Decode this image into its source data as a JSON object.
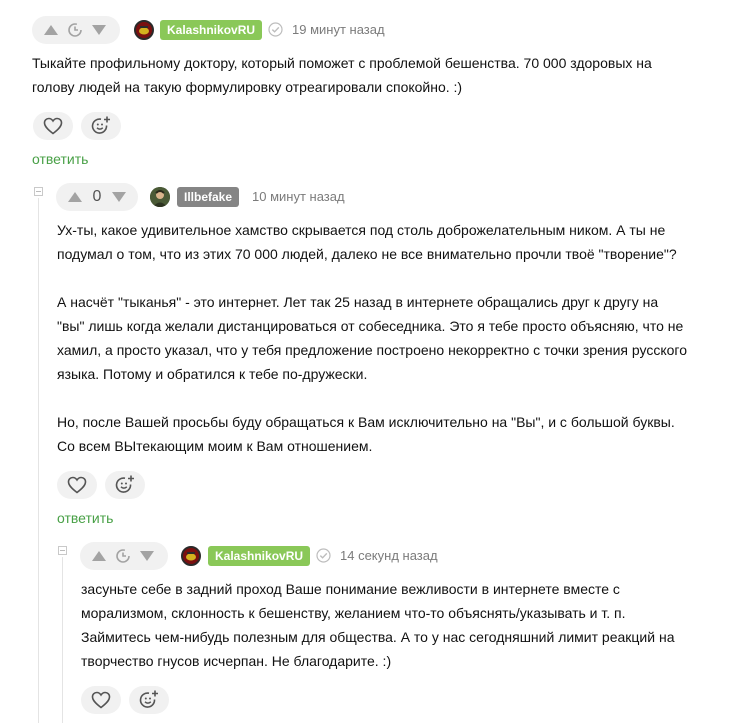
{
  "colors": {
    "accent_green": "#48a046",
    "badge_green": "#8ac858",
    "badge_gray": "#858585",
    "muted_text": "#7b7b7b",
    "pill_bg": "#f1f1f1"
  },
  "icons": {
    "upvote": "triangle-up-icon",
    "downvote": "triangle-down-icon",
    "pending_rating": "rating-timer-icon",
    "verified": "verified-check-icon",
    "like": "heart-icon",
    "react": "smiley-plus-icon"
  },
  "comments": [
    {
      "rating": "",
      "author": "KalashnikovRU",
      "time": "19 минут назад",
      "paragraphs": [
        "Тыкайте профильному доктору, который поможет с проблемой бешенства. 70 000 здоровых на голову людей на такую формулировку отреагировали спокойно. :)"
      ],
      "reply_label": "ответить"
    },
    {
      "rating": "0",
      "author": "Illbefake",
      "time": "10 минут назад",
      "paragraphs": [
        "Ух-ты, какое удивительное хамство скрывается под столь доброжелательным ником. А ты не подумал о том, что из этих 70 000 людей, далеко не все внимательно прочли твоё \"творение\"?",
        "А насчёт \"тыканья\" - это интернет. Лет так 25 назад в интернете обращались друг к другу на \"вы\" лишь когда желали дистанцироваться от собеседника. Это я тебе просто объясняю, что не хамил, а просто указал, что у тебя предложение построено некорректно с точки зрения русского языка. Потому и обратился к тебе по-дружески.",
        "Но, после Вашей просьбы буду обращаться к Вам исключительно на \"Вы\", и с большой буквы. Со всем ВЫтекающим моим к Вам отношением."
      ],
      "reply_label": "ответить"
    },
    {
      "rating": "",
      "author": "KalashnikovRU",
      "time": "14 секунд назад",
      "paragraphs": [
        "засуньте себе в задний проход Ваше понимание вежливости в интернете вместе с морализмом, склонность к бешенству, желанием что-то объяснять/указывать и т. п. Займитесь чем-нибудь полезным для общества. А то у нас сегодняшний лимит реакций на творчество гнусов исчерпан. Не благодарите. :)"
      ]
    }
  ]
}
